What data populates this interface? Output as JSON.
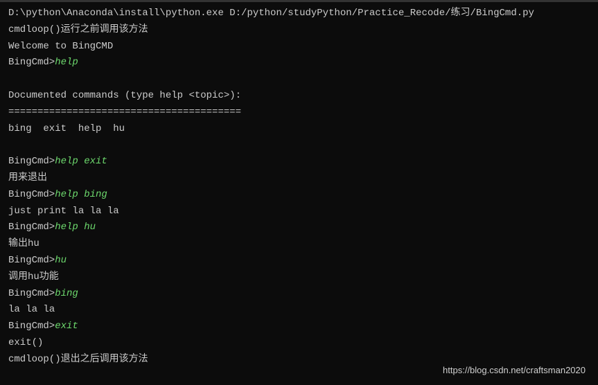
{
  "terminal": {
    "exec_line": "D:\\python\\Anaconda\\install\\python.exe D:/python/studyPython/Practice_Recode/练习/BingCmd.py",
    "preloop": "cmdloop()运行之前调用该方法",
    "welcome": "Welcome to BingCMD",
    "prompt": "BingCmd>",
    "cmd1": "help",
    "doc_header": "Documented commands (type help <topic>):",
    "doc_sep": "========================================",
    "doc_list": "bing  exit  help  hu",
    "cmd2": "help exit",
    "out2": "用来退出",
    "cmd3": "help bing",
    "out3": "just print la la la",
    "cmd4": "help hu",
    "out4": "输出hu",
    "cmd5": "hu",
    "out5": "调用hu功能",
    "cmd6": "bing",
    "out6": "la la la",
    "cmd7": "exit",
    "out7": "exit()",
    "postloop": "cmdloop()退出之后调用该方法"
  },
  "watermark": "https://blog.csdn.net/craftsman2020"
}
